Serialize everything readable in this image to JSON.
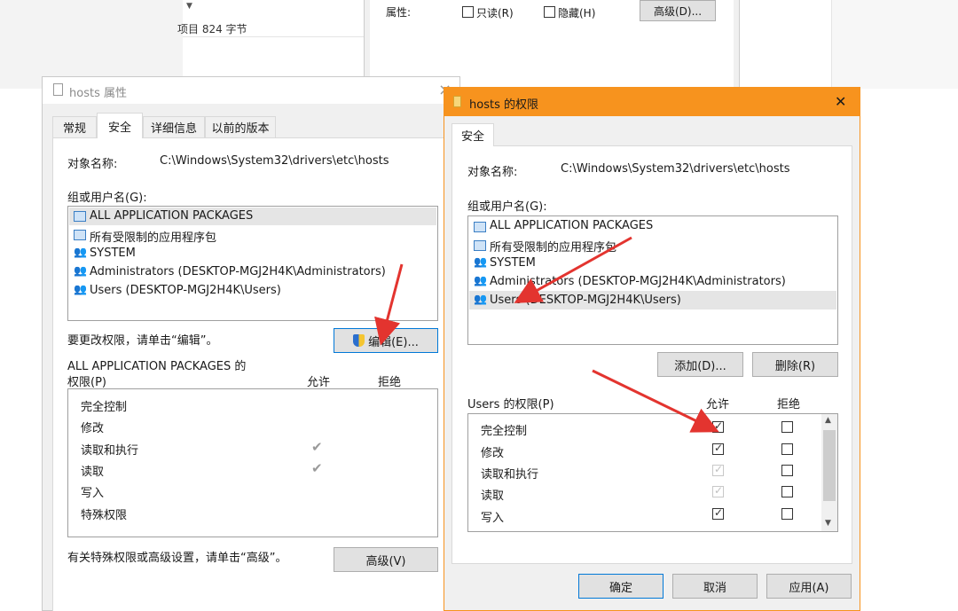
{
  "bg_window": {
    "size_text": "项目 824 字节",
    "attr_label": "属性:",
    "readonly_label": "只读(R)",
    "hidden_label": "隐藏(H)",
    "advanced_label": "高级(D)..."
  },
  "props": {
    "title": "hosts 属性",
    "close": "×",
    "tabs": [
      "常规",
      "安全",
      "详细信息",
      "以前的版本"
    ],
    "object_label": "对象名称:",
    "object_path": "C:\\Windows\\System32\\drivers\\etc\\hosts",
    "group_label": "组或用户名(G):",
    "users": [
      "ALL APPLICATION PACKAGES",
      "所有受限制的应用程序包",
      "SYSTEM",
      "Administrators (DESKTOP-MGJ2H4K\\Administrators)",
      "Users (DESKTOP-MGJ2H4K\\Users)"
    ],
    "change_hint": "要更改权限，请单击“编辑”。",
    "edit_label": "编辑(E)...",
    "perm_title_1": "ALL APPLICATION PACKAGES 的",
    "perm_title_2": "权限(P)",
    "allow": "允许",
    "deny": "拒绝",
    "perms": [
      "完全控制",
      "修改",
      "读取和执行",
      "读取",
      "写入",
      "特殊权限"
    ],
    "perm_allow_checked": [
      false,
      false,
      true,
      true,
      false,
      false
    ],
    "adv_hint": "有关特殊权限或高级设置，请单击“高级”。",
    "adv_label": "高级(V)"
  },
  "perm_dlg": {
    "title": "hosts 的权限",
    "close": "✕",
    "tab": "安全",
    "object_label": "对象名称:",
    "object_path": "C:\\Windows\\System32\\drivers\\etc\\hosts",
    "group_label": "组或用户名(G):",
    "users": [
      "ALL APPLICATION PACKAGES",
      "所有受限制的应用程序包",
      "SYSTEM",
      "Administrators (DESKTOP-MGJ2H4K\\Administrators)",
      "Users (DESKTOP-MGJ2H4K\\Users)"
    ],
    "add_label": "添加(D)...",
    "remove_label": "删除(R)",
    "perm_title": "Users 的权限(P)",
    "allow": "允许",
    "deny": "拒绝",
    "perms": [
      "完全控制",
      "修改",
      "读取和执行",
      "读取",
      "写入"
    ],
    "allow_state": [
      "checked",
      "checked",
      "inherited",
      "inherited",
      "checked"
    ],
    "ok_label": "确定",
    "cancel_label": "取消",
    "apply_label": "应用(A)",
    "accent": "#f7931e"
  }
}
